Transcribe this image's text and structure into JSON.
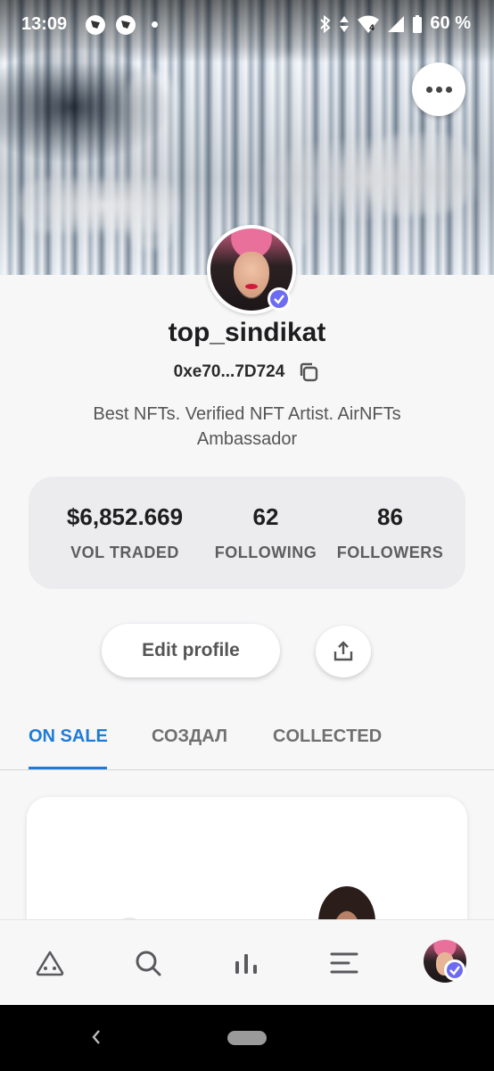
{
  "status_bar": {
    "time": "13:09",
    "battery": "60 %",
    "network": "4"
  },
  "profile": {
    "username": "top_sindikat",
    "address": "0xe70...7D724",
    "bio": "Best NFTs. Verified NFT Artist. AirNFTs Ambassador",
    "verified": true
  },
  "stats": [
    {
      "value": "$6,852.669",
      "label": "VOL TRADED"
    },
    {
      "value": "62",
      "label": "FOLLOWING"
    },
    {
      "value": "86",
      "label": "FOLLOWERS"
    }
  ],
  "actions": {
    "edit_profile": "Edit profile"
  },
  "tabs": [
    {
      "label": "ON SALE",
      "active": true
    },
    {
      "label": "СОЗДАЛ",
      "active": false
    },
    {
      "label": "COLLECTED",
      "active": false
    }
  ],
  "bottom_nav": [
    "home-icon",
    "search-icon",
    "stats-icon",
    "menu-icon",
    "profile-avatar"
  ],
  "colors": {
    "accent": "#1f7bd6",
    "verified": "#6d6cf0"
  }
}
